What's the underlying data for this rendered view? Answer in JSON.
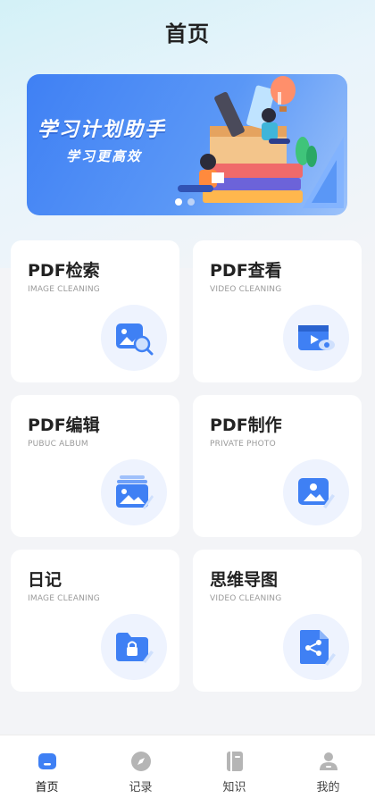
{
  "header": {
    "title": "首页"
  },
  "banner": {
    "title": "学习计划助手",
    "subtitle": "学习更高效",
    "page_count": 2,
    "active_page": 1
  },
  "cards": [
    {
      "title": "PDF检索",
      "subtitle": "IMAGE CLEANING",
      "icon": "image-search-icon"
    },
    {
      "title": "PDF查看",
      "subtitle": "VIDEO CLEANING",
      "icon": "video-view-icon"
    },
    {
      "title": "PDF编辑",
      "subtitle": "PUBUC ALBUM",
      "icon": "album-edit-icon"
    },
    {
      "title": "PDF制作",
      "subtitle": "PRIVATE PHOTO",
      "icon": "photo-edit-icon"
    },
    {
      "title": "日记",
      "subtitle": "IMAGE CLEANING",
      "icon": "locked-folder-icon"
    },
    {
      "title": "思维导图",
      "subtitle": "VIDEO CLEANING",
      "icon": "mindmap-doc-icon"
    }
  ],
  "tabbar": {
    "items": [
      {
        "label": "首页",
        "icon": "home-icon",
        "active": true
      },
      {
        "label": "记录",
        "icon": "compass-icon",
        "active": false
      },
      {
        "label": "知识",
        "icon": "book-icon",
        "active": false
      },
      {
        "label": "我的",
        "icon": "user-icon",
        "active": false
      }
    ]
  },
  "colors": {
    "accent": "#3f80f4",
    "icon_bg": "#eef3fe",
    "icon_gray": "#b5b5b5"
  }
}
